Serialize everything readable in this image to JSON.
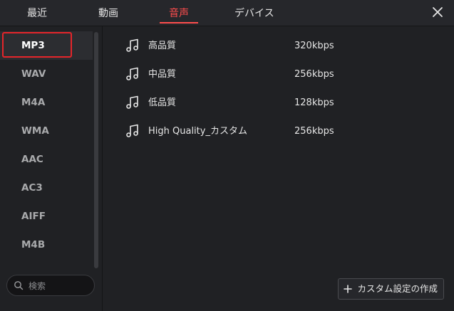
{
  "tabs": [
    {
      "label": "最近",
      "active": false
    },
    {
      "label": "動画",
      "active": false
    },
    {
      "label": "音声",
      "active": true
    },
    {
      "label": "デバイス",
      "active": false
    }
  ],
  "close_icon": "close-icon",
  "sidebar": {
    "formats": [
      "MP3",
      "WAV",
      "M4A",
      "WMA",
      "AAC",
      "AC3",
      "AIFF",
      "M4B"
    ],
    "selected": "MP3",
    "search_placeholder": "検索"
  },
  "presets": [
    {
      "name": "高品質",
      "bitrate": "320kbps",
      "icon": "music-note-icon"
    },
    {
      "name": "中品質",
      "bitrate": "256kbps",
      "icon": "music-note-icon"
    },
    {
      "name": "低品質",
      "bitrate": "128kbps",
      "icon": "music-note-icon"
    },
    {
      "name": "High Quality_カスタム",
      "bitrate": "256kbps",
      "icon": "music-note-icon"
    }
  ],
  "custom_button": {
    "label": "カスタム設定の作成",
    "icon": "plus-icon"
  },
  "colors": {
    "accent": "#ff4d4d",
    "selection_outline": "#e5252a",
    "background": "#202124"
  }
}
